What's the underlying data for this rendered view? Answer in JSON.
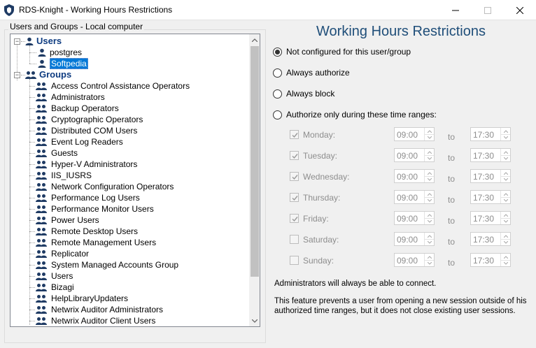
{
  "window": {
    "title": "RDS-Knight - Working Hours Restrictions"
  },
  "tree": {
    "group_label": "Users and Groups - Local computer",
    "users_root": "Users",
    "users": [
      "postgres",
      "Softpedia"
    ],
    "selected_user": "Softpedia",
    "groups_root": "Groups",
    "groups": [
      "Access Control Assistance Operators",
      "Administrators",
      "Backup Operators",
      "Cryptographic Operators",
      "Distributed COM Users",
      "Event Log Readers",
      "Guests",
      "Hyper-V Administrators",
      "IIS_IUSRS",
      "Network Configuration Operators",
      "Performance Log Users",
      "Performance Monitor Users",
      "Power Users",
      "Remote Desktop Users",
      "Remote Management Users",
      "Replicator",
      "System Managed Accounts Group",
      "Users",
      "Bizagi",
      "HelpLibraryUpdaters",
      "Netwrix Auditor Administrators",
      "Netwrix Auditor Client Users"
    ]
  },
  "restrictions": {
    "heading": "Working Hours Restrictions",
    "options": [
      {
        "label": "Not configured for this user/group",
        "checked": true
      },
      {
        "label": "Always authorize",
        "checked": false
      },
      {
        "label": "Always block",
        "checked": false
      },
      {
        "label": "Authorize only during these time ranges:",
        "checked": false
      }
    ],
    "to_label": "to",
    "days": [
      {
        "name": "Monday:",
        "checked": true,
        "from": "09:00",
        "to": "17:30"
      },
      {
        "name": "Tuesday:",
        "checked": true,
        "from": "09:00",
        "to": "17:30"
      },
      {
        "name": "Wednesday:",
        "checked": true,
        "from": "09:00",
        "to": "17:30"
      },
      {
        "name": "Thursday:",
        "checked": true,
        "from": "09:00",
        "to": "17:30"
      },
      {
        "name": "Friday:",
        "checked": true,
        "from": "09:00",
        "to": "17:30"
      },
      {
        "name": "Saturday:",
        "checked": false,
        "from": "09:00",
        "to": "17:30"
      },
      {
        "name": "Sunday:",
        "checked": false,
        "from": "09:00",
        "to": "17:30"
      }
    ],
    "note_admins": "Administrators will always be able to connect.",
    "note_feature_line1": "This feature prevents a user from opening a new session outside of his",
    "note_feature_line2": "authorized time ranges, but it does not close existing user sessions."
  },
  "colors": {
    "heading": "#1f4e79",
    "selection": "#0078d7",
    "tree_icon": "#1f3b64"
  }
}
